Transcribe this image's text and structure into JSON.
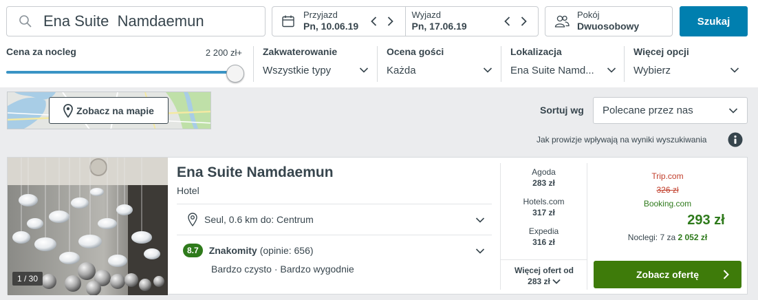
{
  "search": {
    "query": "Ena Suite  Namdaemun",
    "button_label": "Szukaj"
  },
  "dates": {
    "checkin_label": "Przyjazd",
    "checkin_value": "Pn, 10.06.19",
    "checkout_label": "Wyjazd",
    "checkout_value": "Pn, 17.06.19"
  },
  "room": {
    "label": "Pokój",
    "value": "Dwuosobowy"
  },
  "filters": {
    "price": {
      "label": "Cena za nocleg",
      "max": "2 200 zł+",
      "level": 1.0
    },
    "accommodation": {
      "title": "Zakwaterowanie",
      "value": "Wszystkie typy"
    },
    "rating": {
      "title": "Ocena gości",
      "value": "Każda"
    },
    "location": {
      "title": "Lokalizacja",
      "value": "Ena Suite Namd..."
    },
    "more": {
      "title": "Więcej opcji",
      "value": "Wybierz"
    }
  },
  "map": {
    "button_label": "Zobacz na mapie"
  },
  "sort": {
    "label": "Sortuj wg",
    "value": "Polecane przez nas"
  },
  "commission_note": "Jak prowizje wpływają na wyniki wyszukiwania",
  "hotel": {
    "photo_count": "1 / 30",
    "name": "Ena Suite Namdaemun",
    "type": "Hotel",
    "location": "Seul, 0.6 km do: Centrum",
    "rating_score": "8.7",
    "rating_word": "Znakomity",
    "rating_count": "(opinie: 656)",
    "highlights": "Bardzo czysto · Bardzo wygodnie",
    "offers": [
      {
        "provider": "Agoda",
        "price": "283 zł"
      },
      {
        "provider": "Hotels.com",
        "price": "317 zł"
      },
      {
        "provider": "Expedia",
        "price": "316 zł"
      }
    ],
    "more_offers_line1": "Więcej ofert od",
    "more_offers_line2": "283 zł",
    "best": {
      "old_provider": "Trip.com",
      "old_price": "326 zł",
      "provider": "Booking.com",
      "price": "293 zł",
      "nights_prefix": "Noclegi: 7 za",
      "nights_total": "2 052 zł",
      "button_label": "Zobacz ofertę"
    }
  },
  "colors": {
    "primary": "#007faf",
    "deal_green": "#3e7b0a",
    "rating_green": "#2e7a1b",
    "strike_red": "#c13d2a"
  }
}
